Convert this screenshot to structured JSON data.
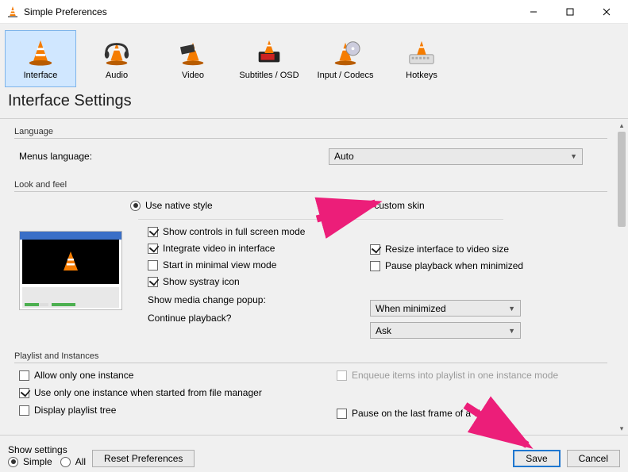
{
  "window": {
    "title": "Simple Preferences"
  },
  "categories": [
    {
      "key": "interface",
      "label": "Interface",
      "selected": true
    },
    {
      "key": "audio",
      "label": "Audio",
      "selected": false
    },
    {
      "key": "video",
      "label": "Video",
      "selected": false
    },
    {
      "key": "subtitles",
      "label": "Subtitles / OSD",
      "selected": false
    },
    {
      "key": "input",
      "label": "Input / Codecs",
      "selected": false
    },
    {
      "key": "hotkeys",
      "label": "Hotkeys",
      "selected": false
    }
  ],
  "page_title": "Interface Settings",
  "language": {
    "group_label": "Language",
    "menus_label": "Menus language:",
    "menus_value": "Auto"
  },
  "look": {
    "group_label": "Look and feel",
    "native_label": "Use native style",
    "custom_label": "Use custom skin",
    "show_controls_fs": "Show controls in full screen mode",
    "integrate_video": "Integrate video in interface",
    "start_minimal": "Start in minimal view mode",
    "show_systray": "Show systray icon",
    "resize_to_video": "Resize interface to video size",
    "pause_minimized": "Pause playback when minimized",
    "media_popup_label": "Show media change popup:",
    "media_popup_value": "When minimized",
    "continue_label": "Continue playback?",
    "continue_value": "Ask"
  },
  "playlist": {
    "group_label": "Playlist and Instances",
    "allow_one": "Allow only one instance",
    "use_one_fm": "Use only one instance when started from file manager",
    "display_tree": "Display playlist tree",
    "enqueue": "Enqueue items into playlist in one instance mode",
    "pause_last": "Pause on the last frame of a video"
  },
  "bottom": {
    "show_settings_label": "Show settings",
    "simple_label": "Simple",
    "all_label": "All",
    "reset_label": "Reset Preferences",
    "save_label": "Save",
    "cancel_label": "Cancel"
  }
}
